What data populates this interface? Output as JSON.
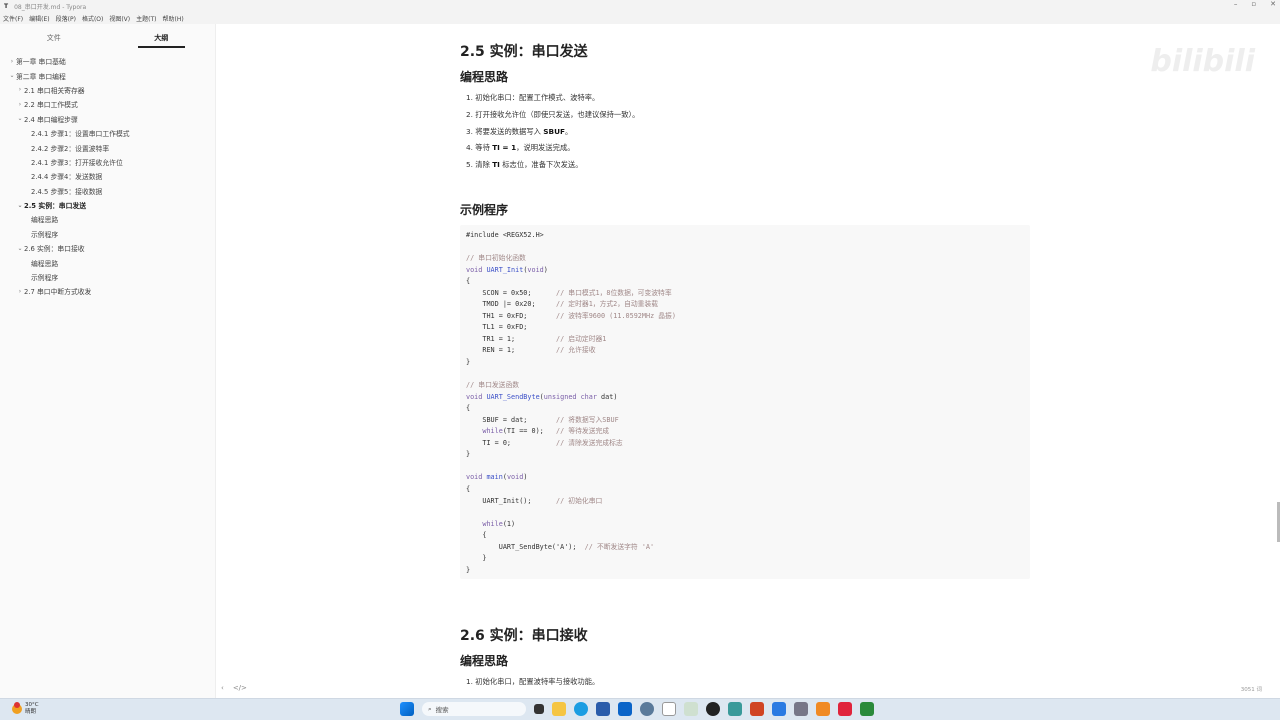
{
  "window": {
    "title": "08_串口开发.md - Typora",
    "app_icon": "T"
  },
  "menu": [
    "文件(F)",
    "编辑(E)",
    "段落(P)",
    "格式(O)",
    "视图(V)",
    "主题(T)",
    "帮助(H)"
  ],
  "sidebar": {
    "tabs": [
      "文件",
      "大纲"
    ],
    "active_tab": "大纲",
    "outline": [
      {
        "label": "第一章 串口基础",
        "level": 1,
        "chev": "›"
      },
      {
        "label": "第二章 串口编程",
        "level": 1,
        "chev": "⌄"
      },
      {
        "label": "2.1 串口相关寄存器",
        "level": 2,
        "chev": "›"
      },
      {
        "label": "2.2 串口工作模式",
        "level": 2,
        "chev": "›"
      },
      {
        "label": "2.4 串口编程步骤",
        "level": 2,
        "chev": "⌄"
      },
      {
        "label": "2.4.1 步骤1：设置串口工作模式",
        "level": 3,
        "chev": ""
      },
      {
        "label": "2.4.2 步骤2：设置波特率",
        "level": 3,
        "chev": ""
      },
      {
        "label": "2.4.1 步骤3：打开接收允许位",
        "level": 3,
        "chev": ""
      },
      {
        "label": "2.4.4 步骤4：发送数据",
        "level": 3,
        "chev": ""
      },
      {
        "label": "2.4.5 步骤5：接收数据",
        "level": 3,
        "chev": ""
      },
      {
        "label": "2.5 实例：串口发送",
        "level": 2,
        "chev": "⌄",
        "active": true
      },
      {
        "label": "编程思路",
        "level": 3,
        "chev": ""
      },
      {
        "label": "示例程序",
        "level": 3,
        "chev": ""
      },
      {
        "label": "2.6 实例：串口接收",
        "level": 2,
        "chev": "⌄"
      },
      {
        "label": "编程思路",
        "level": 3,
        "chev": ""
      },
      {
        "label": "示例程序",
        "level": 3,
        "chev": ""
      },
      {
        "label": "2.7 串口中断方式收发",
        "level": 2,
        "chev": "›"
      }
    ]
  },
  "doc": {
    "h2_a": "2.5 实例：串口发送",
    "h3_a": "编程思路",
    "steps_a": [
      {
        "pre": "1. 初始化串口：配置工作模式、波特率。",
        "b": "",
        "post": ""
      },
      {
        "pre": "2. 打开接收允许位（即使只发送，也建议保持一致）。",
        "b": "",
        "post": ""
      },
      {
        "pre": "3. 将要发送的数据写入 ",
        "b": "SBUF",
        "post": "。"
      },
      {
        "pre": "4. 等待 ",
        "b": "TI = 1",
        "post": "，说明发送完成。"
      },
      {
        "pre": "5. 清除 ",
        "b": "TI",
        "post": " 标志位，准备下次发送。"
      }
    ],
    "h3_b": "示例程序",
    "code": [
      [
        [
          "",
          "#include <REGX52.H>"
        ]
      ],
      [],
      [
        [
          "cm",
          "// 串口初始化函数"
        ]
      ],
      [
        [
          "kw",
          "void "
        ],
        [
          "fn",
          "UART_Init"
        ],
        [
          "",
          "("
        ],
        [
          "kw",
          "void"
        ],
        [
          "",
          ")"
        ]
      ],
      [
        [
          "",
          "{"
        ]
      ],
      [
        [
          "",
          "    SCON = 0x50;      "
        ],
        [
          "cm",
          "// 串口模式1，8位数据，可变波特率"
        ]
      ],
      [
        [
          "",
          "    TMOD |= 0x20;     "
        ],
        [
          "cm",
          "// 定时器1，方式2，自动重装载"
        ]
      ],
      [
        [
          "",
          "    TH1 = 0xFD;       "
        ],
        [
          "cm",
          "// 波特率9600 (11.0592MHz 晶振)"
        ]
      ],
      [
        [
          "",
          "    TL1 = 0xFD;"
        ]
      ],
      [
        [
          "",
          "    TR1 = 1;          "
        ],
        [
          "cm",
          "// 启动定时器1"
        ]
      ],
      [
        [
          "",
          "    REN = 1;          "
        ],
        [
          "cm",
          "// 允许接收"
        ]
      ],
      [
        [
          "",
          "}"
        ]
      ],
      [],
      [
        [
          "cm",
          "// 串口发送函数"
        ]
      ],
      [
        [
          "kw",
          "void "
        ],
        [
          "fn",
          "UART_SendByte"
        ],
        [
          "",
          "("
        ],
        [
          "kw",
          "unsigned char"
        ],
        [
          "",
          " dat)"
        ]
      ],
      [
        [
          "",
          "{"
        ]
      ],
      [
        [
          "",
          "    SBUF = dat;       "
        ],
        [
          "cm",
          "// 将数据写入SBUF"
        ]
      ],
      [
        [
          "",
          "    "
        ],
        [
          "kw",
          "while"
        ],
        [
          "",
          "(TI == 0);   "
        ],
        [
          "cm",
          "// 等待发送完成"
        ]
      ],
      [
        [
          "",
          "    TI = 0;           "
        ],
        [
          "cm",
          "// 清除发送完成标志"
        ]
      ],
      [
        [
          "",
          "}"
        ]
      ],
      [],
      [
        [
          "kw",
          "void "
        ],
        [
          "fn",
          "main"
        ],
        [
          "",
          "("
        ],
        [
          "kw",
          "void"
        ],
        [
          "",
          ")"
        ]
      ],
      [
        [
          "",
          "{"
        ]
      ],
      [
        [
          "",
          "    UART_Init();      "
        ],
        [
          "cm",
          "// 初始化串口"
        ]
      ],
      [],
      [
        [
          "",
          "    "
        ],
        [
          "kw",
          "while"
        ],
        [
          "",
          "(1)"
        ]
      ],
      [
        [
          "",
          "    {"
        ]
      ],
      [
        [
          "",
          "        UART_SendByte('A');  "
        ],
        [
          "cm",
          "// 不断发送字符 'A'"
        ]
      ],
      [
        [
          "",
          "    }"
        ]
      ],
      [
        [
          "",
          "}"
        ]
      ]
    ],
    "h2_b": "2.6 实例：串口接收",
    "h3_c": "编程思路",
    "steps_b": [
      "1. 初始化串口，配置波特率与接收功能。"
    ]
  },
  "footer": {
    "word_count": "3051 词"
  },
  "watermark": "bilibili",
  "taskbar": {
    "weather_temp": "30°C",
    "weather_desc": "晴朗",
    "search_placeholder": "搜索"
  }
}
